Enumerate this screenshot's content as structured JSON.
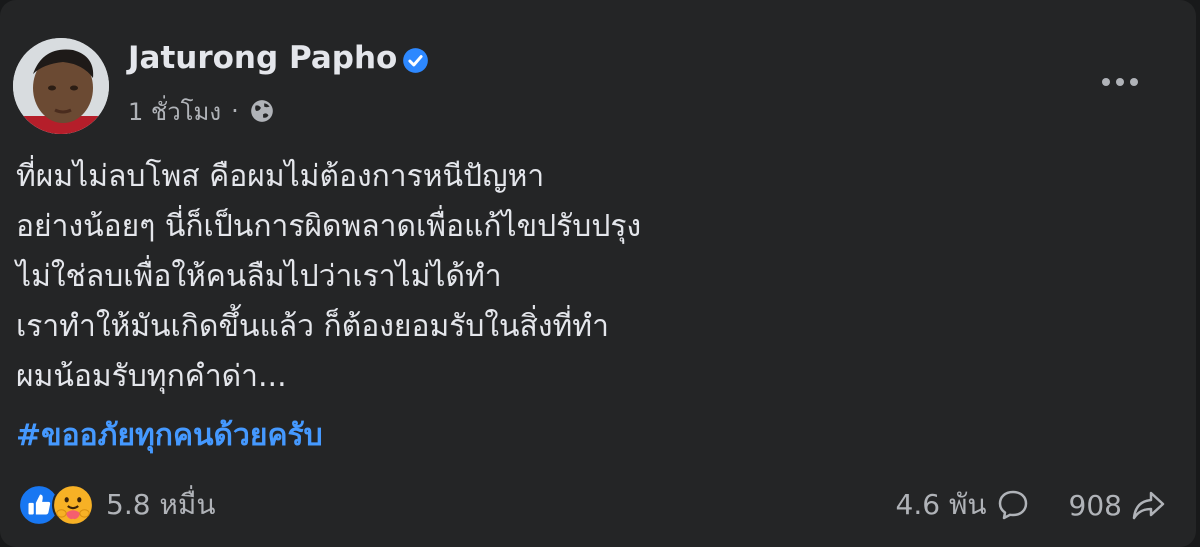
{
  "post": {
    "author": "Jaturong Papho",
    "timestamp": "1 ชั่วโมง",
    "separator": "·",
    "lines": [
      "ที่ผมไม่ลบโพส คือผมไม่ต้องการหนีปัญหา",
      "อย่างน้อยๆ นี่ก็เป็นการผิดพลาดเพื่อแก้ไขปรับปรุง",
      "ไม่ใช่ลบเพื่อให้คนลืมไปว่าเราไม่ได้ทำ",
      "เราทำให้มันเกิดขึ้นแล้ว ก็ต้องยอมรับในสิ่งที่ทำ",
      "ผมน้อมรับทุกคำด่า..."
    ],
    "hashtag": "#ขออภัยทุกคนด้วยครับ"
  },
  "stats": {
    "reactions": "5.8 หมื่น",
    "comments": "4.6 พัน",
    "shares": "908"
  },
  "icons": {
    "verified": "verified-badge-icon",
    "audience": "globe-icon",
    "more": "more-options-icon",
    "reaction_1": "like-icon",
    "reaction_2": "care-icon",
    "comment": "comment-icon",
    "share": "share-icon"
  },
  "colors": {
    "card_bg": "#242526",
    "text": "#e4e6eb",
    "secondary_text": "#b0b3b8",
    "link": "#4599ff",
    "verified": "#2d88ff",
    "like": "#1877f2",
    "care": "#f7b125"
  }
}
